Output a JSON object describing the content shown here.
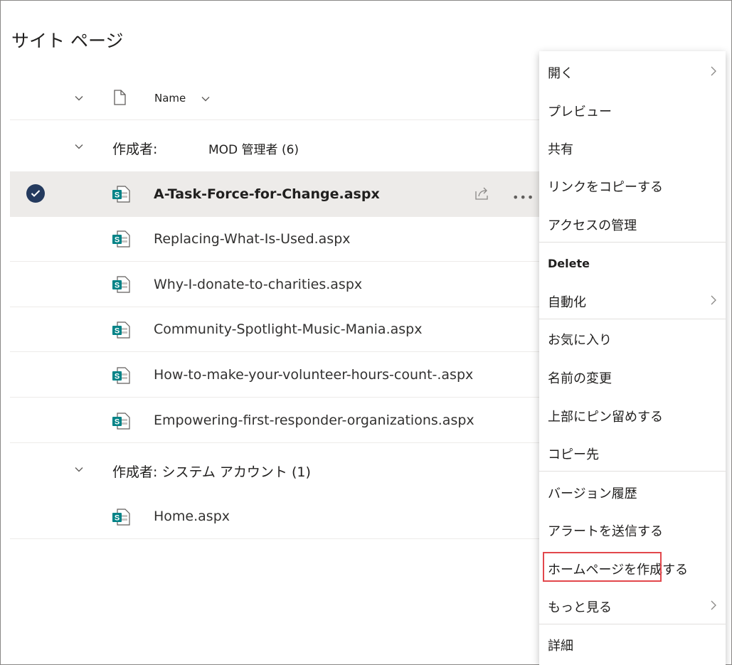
{
  "page": {
    "title": "サイト ページ"
  },
  "header": {
    "name_column": "Name"
  },
  "groups": [
    {
      "label": "作成者:",
      "value": "MOD 管理者 (6)",
      "files": [
        {
          "name": "A-Task-Force-for-Change.aspx",
          "selected": true
        },
        {
          "name": "Replacing-What-Is-Used.aspx",
          "selected": false
        },
        {
          "name": "Why-I-donate-to-charities.aspx",
          "selected": false
        },
        {
          "name": "Community-Spotlight-Music-Mania.aspx",
          "selected": false
        },
        {
          "name": "How-to-make-your-volunteer-hours-count-.aspx",
          "selected": false
        },
        {
          "name": "Empowering-first-responder-organizations.aspx",
          "selected": false
        }
      ]
    },
    {
      "label": "作成者: システム アカウント (1)",
      "files": [
        {
          "name": "Home.aspx",
          "selected": false
        }
      ]
    }
  ],
  "context_menu": {
    "items": [
      {
        "label": "開く",
        "submenu": true
      },
      {
        "label": "プレビュー"
      },
      {
        "label": "共有"
      },
      {
        "label": "リンクをコピーする"
      },
      {
        "label": "アクセスの管理"
      },
      {
        "label": "Delete"
      },
      {
        "label": "自動化",
        "submenu": true
      },
      {
        "label": "お気に入り"
      },
      {
        "label": "名前の変更"
      },
      {
        "label": "上部にピン留めする"
      },
      {
        "label": "コピー先"
      },
      {
        "label": "バージョン履歴"
      },
      {
        "label": "アラートを送信する"
      },
      {
        "label": "ホームページを作成する",
        "highlighted": true
      },
      {
        "label": "もっと見る",
        "submenu": true
      },
      {
        "label": "詳細"
      }
    ]
  },
  "colors": {
    "selection_bg": "#edebe9",
    "check_fill": "#243a5e",
    "sharepoint_teal": "#038387",
    "highlight_border": "#e2474c"
  }
}
